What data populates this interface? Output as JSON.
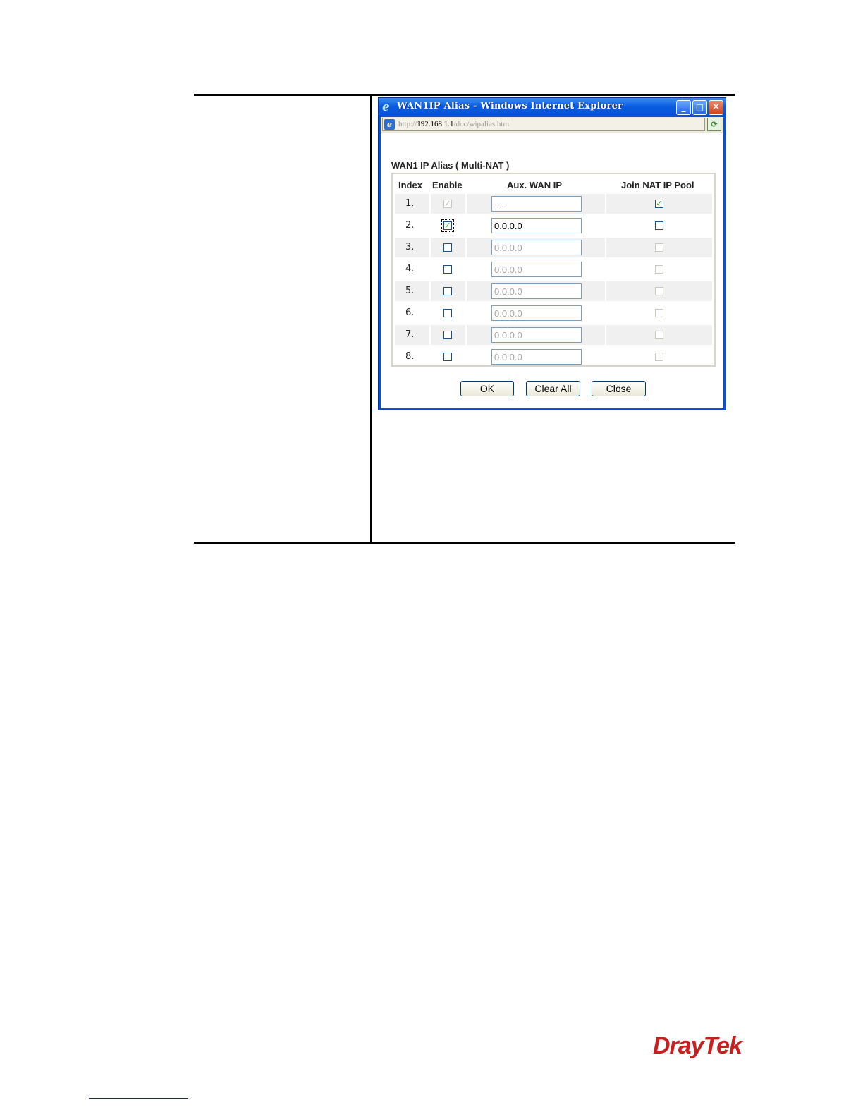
{
  "window": {
    "title": "WAN1IP Alias - Windows Internet Explorer",
    "url_prefix": "http://",
    "url_host": "192.168.1.1",
    "url_path": "/doc/wipalias.htm",
    "icons": [
      "ie-logo-icon",
      "minimize-icon",
      "maximize-icon",
      "close-icon",
      "page-icon",
      "compatibility-icon"
    ]
  },
  "form": {
    "heading": "WAN1 IP Alias ( Multi-NAT )",
    "columns": {
      "index": "Index",
      "enable": "Enable",
      "aux_wan_ip": "Aux. WAN IP",
      "join_pool": "Join NAT IP Pool"
    },
    "rows": [
      {
        "index": "1.",
        "enable": true,
        "enable_disabled": true,
        "ip": "---",
        "ip_disabled": false,
        "join": true,
        "join_disabled": false
      },
      {
        "index": "2.",
        "enable": true,
        "enable_disabled": false,
        "ip": "0.0.0.0",
        "ip_disabled": false,
        "join": false,
        "join_disabled": false
      },
      {
        "index": "3.",
        "enable": false,
        "enable_disabled": false,
        "ip": "0.0.0.0",
        "ip_disabled": true,
        "join": false,
        "join_disabled": true
      },
      {
        "index": "4.",
        "enable": false,
        "enable_disabled": false,
        "ip": "0.0.0.0",
        "ip_disabled": true,
        "join": false,
        "join_disabled": true
      },
      {
        "index": "5.",
        "enable": false,
        "enable_disabled": false,
        "ip": "0.0.0.0",
        "ip_disabled": true,
        "join": false,
        "join_disabled": true
      },
      {
        "index": "6.",
        "enable": false,
        "enable_disabled": false,
        "ip": "0.0.0.0",
        "ip_disabled": true,
        "join": false,
        "join_disabled": true
      },
      {
        "index": "7.",
        "enable": false,
        "enable_disabled": false,
        "ip": "0.0.0.0",
        "ip_disabled": true,
        "join": false,
        "join_disabled": true
      },
      {
        "index": "8.",
        "enable": false,
        "enable_disabled": false,
        "ip": "0.0.0.0",
        "ip_disabled": true,
        "join": false,
        "join_disabled": true
      }
    ],
    "buttons": {
      "ok": "OK",
      "clear_all": "Clear All",
      "close": "Close"
    }
  },
  "branding": {
    "logo_text": "DrayTek",
    "logo_color": "#c8201f"
  }
}
